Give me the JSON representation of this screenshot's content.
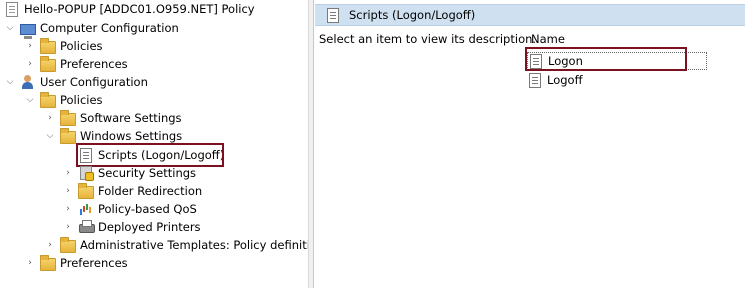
{
  "tree": {
    "root": "Hello-POPUP [ADDC01.O959.NET] Policy",
    "computer_config": "Computer Configuration",
    "cc_policies": "Policies",
    "cc_preferences": "Preferences",
    "user_config": "User Configuration",
    "uc_policies": "Policies",
    "software_settings": "Software Settings",
    "windows_settings": "Windows Settings",
    "scripts": "Scripts (Logon/Logoff)",
    "security_settings": "Security Settings",
    "folder_redirection": "Folder Redirection",
    "policy_qos": "Policy-based QoS",
    "deployed_printers": "Deployed Printers",
    "admin_templates": "Administrative Templates: Policy definition",
    "uc_preferences": "Preferences"
  },
  "right_pane": {
    "header_title": "Scripts (Logon/Logoff)",
    "description": "Select an item to view its description.",
    "column_name": "Name",
    "items": [
      "Logon",
      "Logoff"
    ]
  },
  "colors": {
    "highlight_border": "#7a1020",
    "header_bg": "#cfe0f1"
  }
}
